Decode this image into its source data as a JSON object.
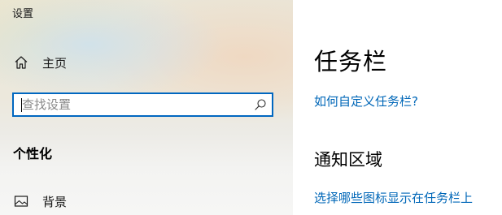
{
  "window": {
    "title": "设置"
  },
  "sidebar": {
    "home": {
      "icon": "home-icon",
      "label": "主页"
    },
    "search": {
      "placeholder": "查找设置",
      "value": "",
      "icon": "search-icon"
    },
    "section_heading": "个性化",
    "items": [
      {
        "icon": "image-icon",
        "label": "背景"
      }
    ]
  },
  "main": {
    "title": "任务栏",
    "help_link": "如何自定义任务栏?",
    "notification_area": {
      "title": "通知区域",
      "link": "选择哪些图标显示在任务栏上"
    }
  },
  "colors": {
    "accent": "#0067c0",
    "link": "#0067b8"
  }
}
